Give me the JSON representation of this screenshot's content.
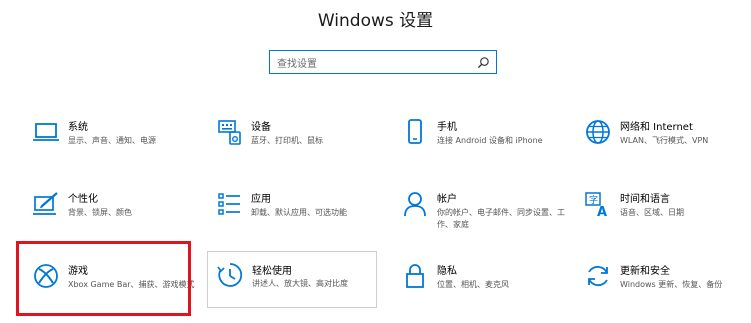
{
  "window": {
    "title": "Windows 设置"
  },
  "search": {
    "placeholder": "查找设置",
    "icon": "search-icon"
  },
  "accent_color": "#0078d7",
  "highlight_color": "#e0141e",
  "tiles": [
    {
      "name": "系统",
      "desc": "显示、声音、通知、电源",
      "icon": "monitor-icon"
    },
    {
      "name": "设备",
      "desc": "蓝牙、打印机、鼠标",
      "icon": "keyboard-icon"
    },
    {
      "name": "手机",
      "desc": "连接 Android 设备和 iPhone",
      "icon": "phone-icon"
    },
    {
      "name": "网络和 Internet",
      "desc": "WLAN、飞行模式、VPN",
      "icon": "globe-icon"
    },
    {
      "name": "个性化",
      "desc": "背景、锁屏、颜色",
      "icon": "brush-icon"
    },
    {
      "name": "应用",
      "desc": "卸载、默认应用、可选功能",
      "icon": "apps-list-icon"
    },
    {
      "name": "帐户",
      "desc": "你的帐户、电子邮件、同步设置、工作、家庭",
      "icon": "person-icon"
    },
    {
      "name": "时间和语言",
      "desc": "语音、区域、日期",
      "icon": "language-icon"
    },
    {
      "name": "游戏",
      "desc": "Xbox Game Bar、捕获、游戏模式",
      "icon": "xbox-icon"
    },
    {
      "name": "轻松使用",
      "desc": "讲述人、放大镜、高对比度",
      "icon": "ease-of-access-icon"
    },
    {
      "name": "隐私",
      "desc": "位置、相机、麦克风",
      "icon": "lock-icon"
    },
    {
      "name": "更新和安全",
      "desc": "Windows 更新、恢复、备份",
      "icon": "sync-icon"
    }
  ]
}
